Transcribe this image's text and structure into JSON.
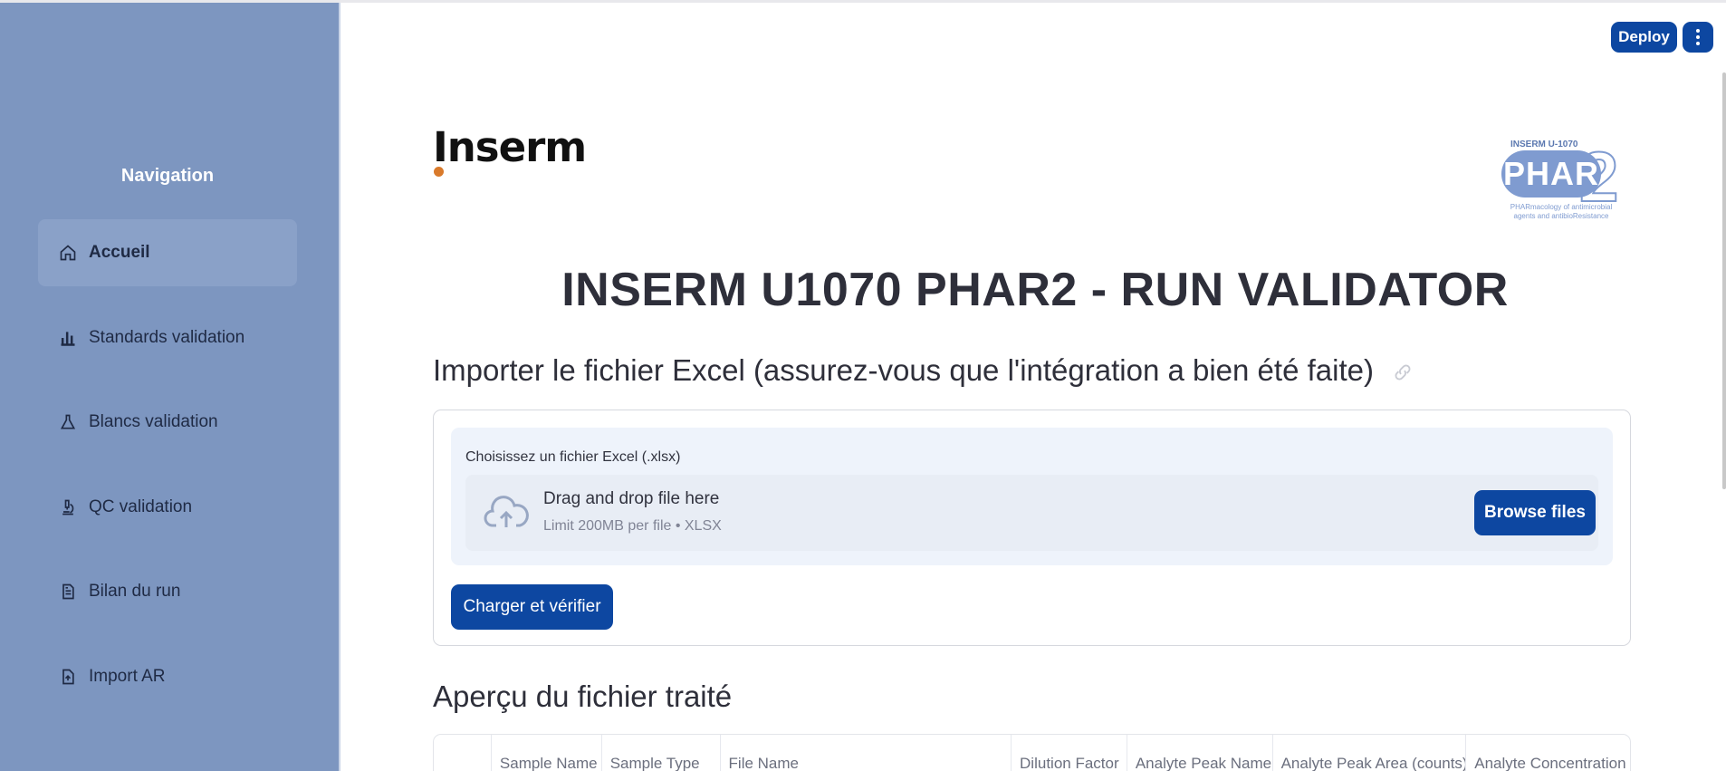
{
  "toolbar": {
    "deploy_label": "Deploy",
    "menu_icon": "vertical-ellipsis-icon"
  },
  "sidebar": {
    "title": "Navigation",
    "items": [
      {
        "label": "Accueil",
        "icon": "home-icon",
        "active": true
      },
      {
        "label": "Standards validation",
        "icon": "bar-chart-icon",
        "active": false
      },
      {
        "label": "Blancs validation",
        "icon": "flask-icon",
        "active": false
      },
      {
        "label": "QC validation",
        "icon": "microscope-icon",
        "active": false
      },
      {
        "label": "Bilan du run",
        "icon": "document-icon",
        "active": false
      },
      {
        "label": "Import AR",
        "icon": "file-upload-icon",
        "active": false
      }
    ]
  },
  "logos": {
    "inserm": "Inserm",
    "phar2_top": "INSERM U-1070",
    "phar2_word": "PHAR",
    "phar2_digit": "2",
    "phar2_sub_line1": "PHARmacology of antimicrobial",
    "phar2_sub_line2": "agents and antibioResistance"
  },
  "main": {
    "title": "INSERM U1070 PHAR2 - RUN VALIDATOR",
    "import_heading": "Importer le fichier Excel (assurez-vous que l'intégration a bien été faite)",
    "uploader": {
      "label": "Choisissez un fichier Excel (.xlsx)",
      "drop_text": "Drag and drop file here",
      "limit_text": "Limit 200MB per file • XLSX",
      "browse_label": "Browse files"
    },
    "charger_label": "Charger et vérifier",
    "apercu_heading": "Aperçu du fichier traité",
    "table_columns": [
      "",
      "Sample Name",
      "Sample Type",
      "File Name",
      "Dilution Factor",
      "Analyte Peak Name",
      "Analyte Peak Area (counts)",
      "Analyte Concentration ("
    ]
  },
  "colors": {
    "sidebar_bg": "#7d96c0",
    "primary": "#0d47a1",
    "uploader_bg": "#eef3fb"
  }
}
